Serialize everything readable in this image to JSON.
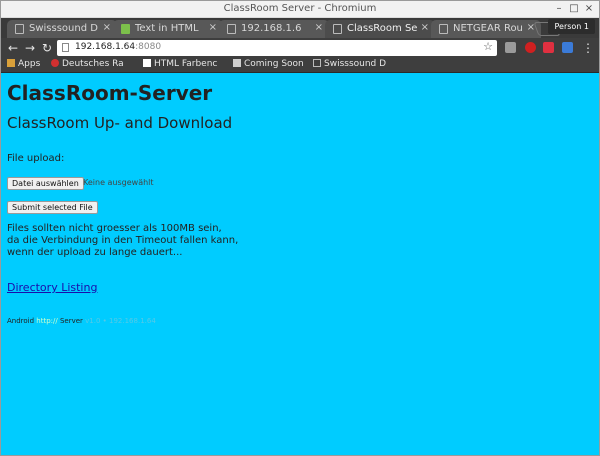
{
  "window": {
    "title": "ClassRoom Server - Chromium",
    "controls": [
      "–",
      "□",
      "×"
    ]
  },
  "tabs": [
    {
      "label": "Swisssound D",
      "active": false
    },
    {
      "label": "Text in HTML",
      "active": false
    },
    {
      "label": "192.168.1.6",
      "active": false
    },
    {
      "label": "ClassRoom Se",
      "active": true
    },
    {
      "label": "NETGEAR Rou",
      "active": false
    }
  ],
  "profile": {
    "label": "Person 1"
  },
  "toolbar": {
    "url_host": "192.168.1.64",
    "url_port": ":8080"
  },
  "bookmarks": [
    {
      "label": "Apps"
    },
    {
      "label": "Deutsches Ra"
    },
    {
      "label": "HTML Farbenc"
    },
    {
      "label": "Coming Soon"
    },
    {
      "label": "Swisssound D"
    }
  ],
  "page": {
    "heading": "ClassRoom-Server",
    "subheading": "ClassRoom Up- and Download",
    "file_upload_label": "File upload:",
    "choose_file_button": "Datei auswählen",
    "no_file_text": "Keine ausgewählt",
    "submit_button": "Submit selected File",
    "info_line1": "Files sollten nicht groesser als 100MB sein,",
    "info_line2": "da die Verbindung in den Timeout fallen kann,",
    "info_line3": "wenn der upload zu lange dauert...",
    "directory_link": "Directory Listing",
    "footer_prefix": "Android ",
    "footer_highlight": "http://",
    "footer_middle": " Server",
    "footer_faint": " v1.0 • 192.168.1.64"
  },
  "colors": {
    "page_bg": "#00ccff",
    "link": "#1a0dab",
    "chrome_dark": "#3e3e3e"
  }
}
